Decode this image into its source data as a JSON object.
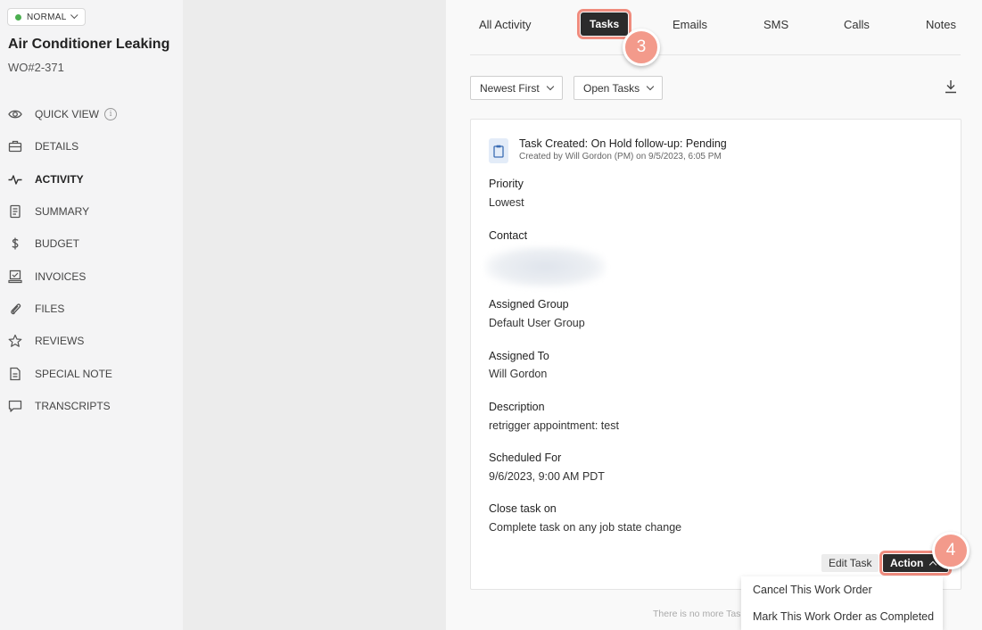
{
  "sidebar": {
    "status_label": "NORMAL",
    "title": "Air Conditioner Leaking",
    "wo_number": "WO#2-371",
    "items": [
      {
        "label": "QUICK VIEW",
        "icon": "eye-icon"
      },
      {
        "label": "DETAILS",
        "icon": "briefcase-icon"
      },
      {
        "label": "ACTIVITY",
        "icon": "activity-icon"
      },
      {
        "label": "SUMMARY",
        "icon": "document-icon"
      },
      {
        "label": "BUDGET",
        "icon": "dollar-icon"
      },
      {
        "label": "INVOICES",
        "icon": "invoice-icon"
      },
      {
        "label": "FILES",
        "icon": "paperclip-icon"
      },
      {
        "label": "REVIEWS",
        "icon": "star-icon"
      },
      {
        "label": "SPECIAL NOTE",
        "icon": "note-icon"
      },
      {
        "label": "TRANSCRIPTS",
        "icon": "chat-icon"
      }
    ],
    "info_glyph": "i"
  },
  "tabs": [
    {
      "label": "All Activity"
    },
    {
      "label": "Tasks"
    },
    {
      "label": "Emails"
    },
    {
      "label": "SMS"
    },
    {
      "label": "Calls"
    },
    {
      "label": "Notes"
    }
  ],
  "markers": {
    "tasks": "3",
    "action": "4"
  },
  "filters": {
    "sort": "Newest First",
    "status": "Open Tasks"
  },
  "task": {
    "title": "Task Created: On Hold follow-up: Pending",
    "subtitle": "Created by Will Gordon (PM) on 9/5/2023, 6:05 PM",
    "fields": [
      {
        "label": "Priority",
        "value": "Lowest"
      },
      {
        "label": "Contact",
        "value": ""
      },
      {
        "label": "Assigned Group",
        "value": "Default User Group"
      },
      {
        "label": "Assigned To",
        "value": "Will Gordon"
      },
      {
        "label": "Description",
        "value": "retrigger appointment: test"
      },
      {
        "label": "Scheduled For",
        "value": "9/6/2023, 9:00 AM PDT"
      },
      {
        "label": "Close task on",
        "value": "Complete task on any job state change"
      }
    ],
    "edit_label": "Edit Task",
    "action_label": "Action"
  },
  "footer_text": "There is no more Tas",
  "action_menu": [
    {
      "label": "Cancel This Work Order"
    },
    {
      "label": "Mark This Work Order as Completed"
    }
  ],
  "colors": {
    "accent_highlight": "#f08c7e",
    "marker": "#f39a8b",
    "status_dot": "#4caf50"
  }
}
